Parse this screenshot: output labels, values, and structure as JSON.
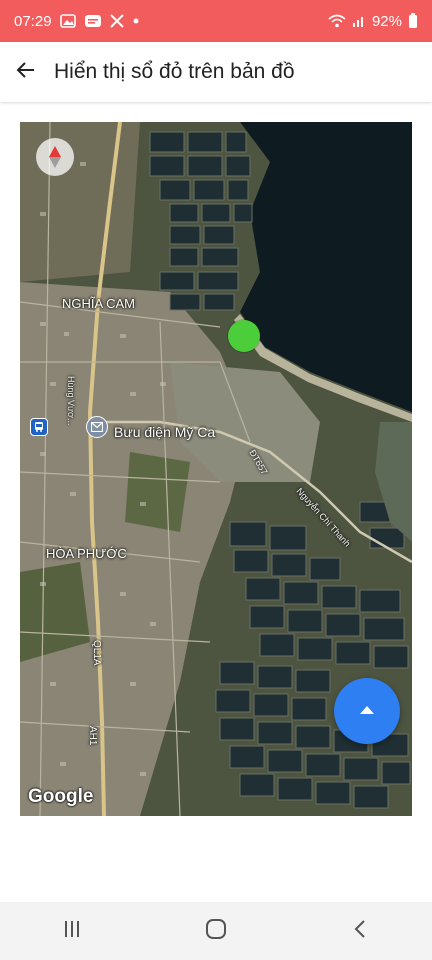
{
  "status_bar": {
    "time": "07:29",
    "battery": "92%",
    "notification_icons": [
      "gallery-icon",
      "blogger-icon",
      "x-icon",
      "dot-icon"
    ],
    "system_icons": [
      "wifi-icon",
      "signal-icon",
      "battery-icon"
    ],
    "colors": {
      "background": "#f25c5c",
      "text": "#ffffff"
    }
  },
  "app_bar": {
    "back_icon": "arrow-left-icon",
    "title": "Hiển thị sổ đỏ trên bản đồ"
  },
  "map": {
    "labels": {
      "nghia_cam": "NGHĨA CAM",
      "hoa_phuoc": "HÒA PHƯỚC",
      "buu_dien": "Bưu điện Mỹ Ca",
      "hung_vuong": "Hùng Vươ...",
      "dt657": "ĐT657",
      "nguyen_chi_thanh": "Nguyễn Chí Thanh",
      "ql1a": "QL1A",
      "ah1": "AH1"
    },
    "attribution": "Google",
    "compass_icon": "compass-icon",
    "poi_icon": "post-office-icon",
    "bus_icon": "bus-stop-icon",
    "marker_color": "#4ccd3a",
    "fab_icon": "triangle-up-icon",
    "fab_color": "#2d7ff2"
  },
  "nav_bar": {
    "recents_icon": "recent-apps-icon",
    "home_icon": "home-icon",
    "back_icon": "back-chevron-icon"
  }
}
